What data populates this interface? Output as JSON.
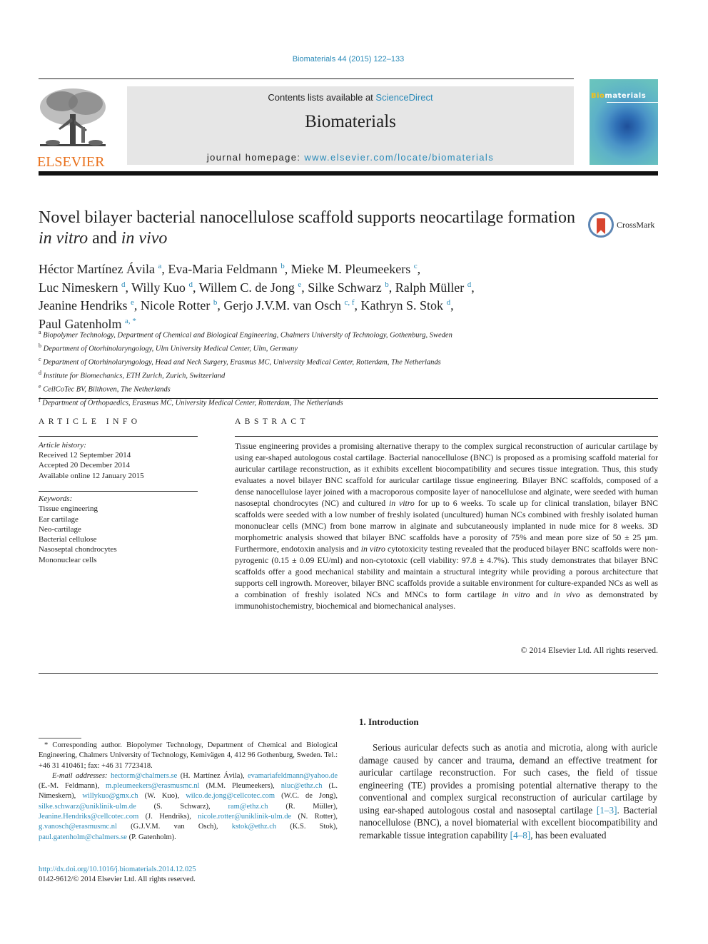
{
  "header": {
    "journal_ref": "Biomaterials 44 (2015) 122–133",
    "contents_prefix": "Contents lists available at ",
    "contents_link": "ScienceDirect",
    "journal_name": "Biomaterials",
    "homepage_prefix": "journal homepage: ",
    "homepage_link": "www.elsevier.com/locate/biomaterials",
    "publisher_logo": "ELSEVIER",
    "cover_title_accent": "Bio",
    "cover_title_rest": "materials",
    "crossmark_label": "CrossMark"
  },
  "article": {
    "title_part1": "Novel bilayer bacterial nanocellulose scaffold supports neocartilage formation ",
    "title_italic1": "in vitro",
    "title_part2": " and ",
    "title_italic2": "in vivo",
    "authors": [
      {
        "name": "Héctor Martínez Ávila",
        "aff": "a"
      },
      {
        "name": "Eva-Maria Feldmann",
        "aff": "b"
      },
      {
        "name": "Mieke M. Pleumeekers",
        "aff": "c"
      },
      {
        "name": "Luc Nimeskern",
        "aff": "d"
      },
      {
        "name": "Willy Kuo",
        "aff": "d"
      },
      {
        "name": "Willem C. de Jong",
        "aff": "e"
      },
      {
        "name": "Silke Schwarz",
        "aff": "b"
      },
      {
        "name": "Ralph Müller",
        "aff": "d"
      },
      {
        "name": "Jeanine Hendriks",
        "aff": "e"
      },
      {
        "name": "Nicole Rotter",
        "aff": "b"
      },
      {
        "name": "Gerjo J.V.M. van Osch",
        "aff": "c, f"
      },
      {
        "name": "Kathryn S. Stok",
        "aff": "d"
      },
      {
        "name": "Paul Gatenholm",
        "aff": "a, *"
      }
    ],
    "affiliations": [
      {
        "key": "a",
        "text": "Biopolymer Technology, Department of Chemical and Biological Engineering, Chalmers University of Technology, Gothenburg, Sweden"
      },
      {
        "key": "b",
        "text": "Department of Otorhinolaryngology, Ulm University Medical Center, Ulm, Germany"
      },
      {
        "key": "c",
        "text": "Department of Otorhinolaryngology, Head and Neck Surgery, Erasmus MC, University Medical Center, Rotterdam, The Netherlands"
      },
      {
        "key": "d",
        "text": "Institute for Biomechanics, ETH Zurich, Zurich, Switzerland"
      },
      {
        "key": "e",
        "text": "CellCoTec BV, Bilthoven, The Netherlands"
      },
      {
        "key": "f",
        "text": "Department of Orthopaedics, Erasmus MC, University Medical Center, Rotterdam, The Netherlands"
      }
    ]
  },
  "article_info": {
    "heading": "ARTICLE INFO",
    "history_label": "Article history:",
    "history": [
      "Received 12 September 2014",
      "Accepted 20 December 2014",
      "Available online 12 January 2015"
    ],
    "keywords_label": "Keywords:",
    "keywords": [
      "Tissue engineering",
      "Ear cartilage",
      "Neo-cartilage",
      "Bacterial cellulose",
      "Nasoseptal chondrocytes",
      "Mononuclear cells"
    ]
  },
  "abstract": {
    "heading": "ABSTRACT",
    "segments": [
      {
        "t": "Tissue engineering provides a promising alternative therapy to the complex surgical reconstruction of auricular cartilage by using ear-shaped autologous costal cartilage. Bacterial nanocellulose (BNC) is proposed as a promising scaffold material for auricular cartilage reconstruction, as it exhibits excellent biocompatibility and secures tissue integration. Thus, this study evaluates a novel bilayer BNC scaffold for auricular cartilage tissue engineering. Bilayer BNC scaffolds, composed of a dense nanocellulose layer joined with a macroporous composite layer of nanocellulose and alginate, were seeded with human nasoseptal chondrocytes (NC) and cultured ",
        "i": false
      },
      {
        "t": "in vitro",
        "i": true
      },
      {
        "t": " for up to 6 weeks. To scale up for clinical translation, bilayer BNC scaffolds were seeded with a low number of freshly isolated (uncultured) human NCs combined with freshly isolated human mononuclear cells (MNC) from bone marrow in alginate and subcutaneously implanted in nude mice for 8 weeks. 3D morphometric analysis showed that bilayer BNC scaffolds have a porosity of 75% and mean pore size of 50 ± 25 µm. Furthermore, endotoxin analysis and ",
        "i": false
      },
      {
        "t": "in vitro",
        "i": true
      },
      {
        "t": " cytotoxicity testing revealed that the produced bilayer BNC scaffolds were non-pyrogenic (0.15 ± 0.09 EU/ml) and non-cytotoxic (cell viability: 97.8 ± 4.7%). This study demonstrates that bilayer BNC scaffolds offer a good mechanical stability and maintain a structural integrity while providing a porous architecture that supports cell ingrowth. Moreover, bilayer BNC scaffolds provide a suitable environment for culture-expanded NCs as well as a combination of freshly isolated NCs and MNCs to form cartilage ",
        "i": false
      },
      {
        "t": "in vitro",
        "i": true
      },
      {
        "t": " and ",
        "i": false
      },
      {
        "t": "in vivo",
        "i": true
      },
      {
        "t": " as demonstrated by immunohistochemistry, biochemical and biomechanical analyses.",
        "i": false
      }
    ],
    "copyright": "© 2014 Elsevier Ltd. All rights reserved."
  },
  "footnote": {
    "corresponding": "* Corresponding author. Biopolymer Technology, Department of Chemical and Biological Engineering, Chalmers University of Technology, Kemivägen 4, 412 96 Gothenburg, Sweden. Tel.: +46 31 410461; fax: +46 31 7723418.",
    "email_label": "E-mail addresses:",
    "emails": [
      {
        "email": "hectorm@chalmers.se",
        "who": "(H. Martínez Ávila)"
      },
      {
        "email": "evamariafeldmann@yahoo.de",
        "who": "(E.-M. Feldmann)"
      },
      {
        "email": "m.pleumeekers@erasmusmc.nl",
        "who": "(M.M. Pleumeekers)"
      },
      {
        "email": "nluc@ethz.ch",
        "who": "(L. Nimeskern)"
      },
      {
        "email": "willykuo@gmx.ch",
        "who": "(W. Kuo)"
      },
      {
        "email": "wilco.de.jong@cellcotec.com",
        "who": "(W.C. de Jong)"
      },
      {
        "email": "silke.schwarz@uniklinik-ulm.de",
        "who": "(S. Schwarz)"
      },
      {
        "email": "ram@ethz.ch",
        "who": "(R. Müller)"
      },
      {
        "email": "Jeanine.Hendriks@cellcotec.com",
        "who": "(J. Hendriks)"
      },
      {
        "email": "nicole.rotter@uniklinik-ulm.de",
        "who": "(N. Rotter)"
      },
      {
        "email": "g.vanosch@erasmusmc.nl",
        "who": "(G.J.V.M. van Osch)"
      },
      {
        "email": "kstok@ethz.ch",
        "who": "(K.S. Stok)"
      },
      {
        "email": "paul.gatenholm@chalmers.se",
        "who": "(P. Gatenholm)."
      }
    ],
    "doi": "http://dx.doi.org/10.1016/j.biomaterials.2014.12.025",
    "issn_line": "0142-9612/© 2014 Elsevier Ltd. All rights reserved."
  },
  "introduction": {
    "heading": "1.  Introduction",
    "text_1": "Serious auricular defects such as anotia and microtia, along with auricle damage caused by cancer and trauma, demand an effective treatment for auricular cartilage reconstruction. For such cases, the field of tissue engineering (TE) provides a promising potential alternative therapy to the conventional and complex surgical reconstruction of auricular cartilage by using ear-shaped autologous costal and nasoseptal cartilage ",
    "ref_1": "[1–3]",
    "text_2": ". Bacterial nanocellulose (BNC), a novel biomaterial with excellent biocompatibility and remarkable tissue integration capability ",
    "ref_2": "[4–8]",
    "text_3": ", has been evaluated"
  },
  "colors": {
    "link": "#2a8ab8",
    "elsevier_orange": "#e9711c",
    "masthead_bg": "#e6e6e6"
  }
}
